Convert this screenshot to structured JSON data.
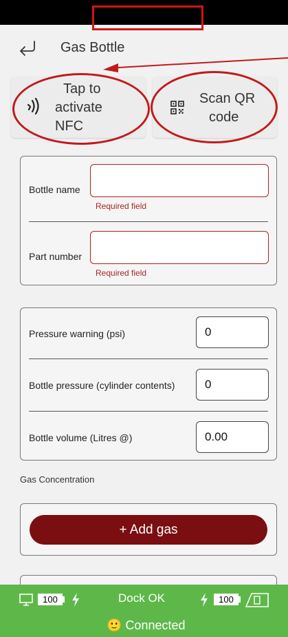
{
  "header": {
    "title": "Gas Bottle",
    "back_icon": "back-arrow-icon"
  },
  "actions": {
    "nfc": {
      "label_lines": [
        "Tap to",
        "activate",
        "NFC"
      ],
      "icon": "nfc-icon"
    },
    "qr": {
      "label_lines": [
        "Scan QR",
        "code"
      ],
      "icon": "qr-code-icon"
    }
  },
  "identity": {
    "bottle_name": {
      "label": "Bottle name",
      "value": "",
      "error": "Required field"
    },
    "part_number": {
      "label": "Part number",
      "value": "",
      "error": "Required field"
    }
  },
  "pressures": {
    "warning": {
      "label": "Pressure warning (psi)",
      "value": "0"
    },
    "bottle_pressure": {
      "label": "Bottle pressure (cylinder contents)",
      "value": "0"
    },
    "bottle_volume": {
      "label": "Bottle volume (Litres @)",
      "value": "0.00"
    }
  },
  "gas": {
    "section_label": "Gas Concentration",
    "add_button": "+ Add gas"
  },
  "status_bar": {
    "left_battery": "100",
    "dock_status": "Dock OK",
    "right_battery": "100",
    "connection": "Connected",
    "connection_emoji": "🙂"
  },
  "colors": {
    "accent": "#7a0e10",
    "status_bg": "#5db849",
    "annotation": "#c21a1a"
  }
}
